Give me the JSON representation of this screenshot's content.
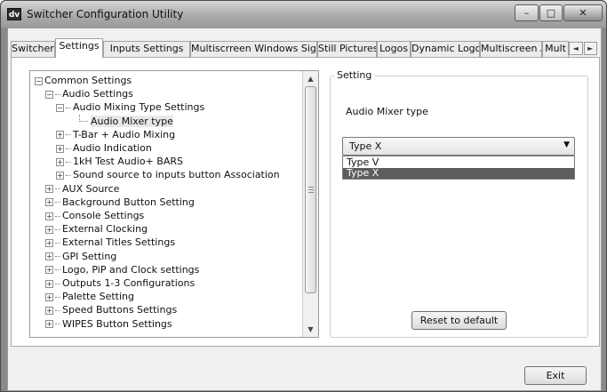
{
  "window": {
    "app_icon_text": "dv",
    "title": "Switcher Configuration Utility",
    "controls": {
      "minimize": "–",
      "maximize": "□",
      "close": "✕"
    }
  },
  "tabs": [
    {
      "label": "Switcher"
    },
    {
      "label": "Settings"
    },
    {
      "label": "Inputs Settings"
    },
    {
      "label": "Multiscrreen Windows Signs"
    },
    {
      "label": "Still Pictures"
    },
    {
      "label": "Logos"
    },
    {
      "label": "Dynamic Logo"
    },
    {
      "label": "Multiscreen A"
    },
    {
      "label": "Mult"
    }
  ],
  "active_tab": "Settings",
  "tab_scroll": {
    "left": "◄",
    "right": "►"
  },
  "tree": {
    "items": [
      {
        "label": "Common Settings",
        "level": 0,
        "expander": "−"
      },
      {
        "label": "Audio Settings",
        "level": 1,
        "expander": "−"
      },
      {
        "label": "Audio Mixing Type  Settings",
        "level": 2,
        "expander": "−"
      },
      {
        "label": "Audio Mixer type",
        "level": 3,
        "expander": "",
        "selected": true
      },
      {
        "label": "T-Bar + Audio Mixing",
        "level": 2,
        "expander": "+"
      },
      {
        "label": "Audio Indication",
        "level": 2,
        "expander": "+"
      },
      {
        "label": "1kH Test Audio+ BARS",
        "level": 2,
        "expander": "+"
      },
      {
        "label": "Sound source to inputs button Association",
        "level": 2,
        "expander": "+"
      },
      {
        "label": "AUX Source",
        "level": 1,
        "expander": "+"
      },
      {
        "label": "Background  Button Setting",
        "level": 1,
        "expander": "+"
      },
      {
        "label": "Console Settings",
        "level": 1,
        "expander": "+"
      },
      {
        "label": "External Clocking",
        "level": 1,
        "expander": "+"
      },
      {
        "label": "External Titles Settings",
        "level": 1,
        "expander": "+"
      },
      {
        "label": "GPI Setting",
        "level": 1,
        "expander": "+"
      },
      {
        "label": "Logo, PiP and Clock settings",
        "level": 1,
        "expander": "+"
      },
      {
        "label": "Outputs 1-3 Configurations",
        "level": 1,
        "expander": "+"
      },
      {
        "label": "Palette Setting",
        "level": 1,
        "expander": "+"
      },
      {
        "label": "Speed Buttons Settings",
        "level": 1,
        "expander": "+"
      },
      {
        "label": "WIPES Button  Settings",
        "level": 1,
        "expander": "+"
      }
    ],
    "scroll_up": "▲",
    "scroll_down": "▼"
  },
  "setting": {
    "group_title": "Setting",
    "label": "Audio Mixer type",
    "combo_value": "Type X",
    "combo_arrow": "▼",
    "options": [
      {
        "label": "Type V",
        "selected": false
      },
      {
        "label": "Type X",
        "selected": true
      }
    ],
    "reset_label": "Reset to default"
  },
  "exit_label": "Exit"
}
